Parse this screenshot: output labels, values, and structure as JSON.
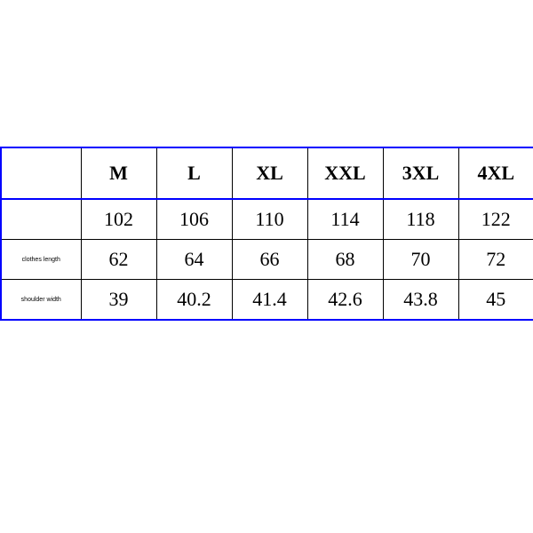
{
  "chart_data": {
    "type": "table",
    "title": "",
    "columns": [
      "",
      "M",
      "L",
      "XL",
      "XXL",
      "3XL",
      "4XL"
    ],
    "rows": [
      {
        "label": "",
        "values": [
          102,
          106,
          110,
          114,
          118,
          122
        ]
      },
      {
        "label": "clothes length",
        "values": [
          62,
          64,
          66,
          68,
          70,
          72
        ]
      },
      {
        "label": "shoulder width",
        "values": [
          39,
          40.2,
          41.4,
          42.6,
          43.8,
          45
        ]
      }
    ]
  }
}
